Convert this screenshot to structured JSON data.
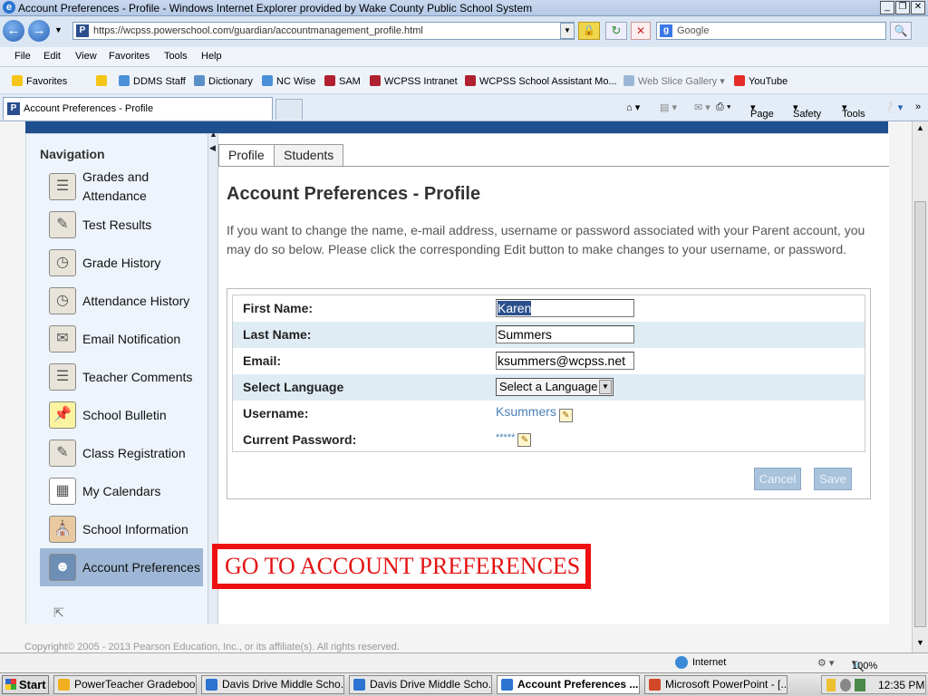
{
  "window": {
    "title": "Account Preferences - Profile - Windows Internet Explorer provided by Wake County Public School System"
  },
  "browser": {
    "url": "https://wcpss.powerschool.com/guardian/accountmanagement_profile.html",
    "search_placeholder": "Google",
    "menu": [
      "File",
      "Edit",
      "View",
      "Favorites",
      "Tools",
      "Help"
    ],
    "favorites_label": "Favorites",
    "favorites": [
      "DDMS Staff",
      "Dictionary",
      "NC Wise",
      "SAM",
      "WCPSS Intranet",
      "WCPSS School Assistant Mo...",
      "Web Slice Gallery",
      "YouTube"
    ],
    "tab_title": "Account Preferences - Profile",
    "commands": [
      "Page",
      "Safety",
      "Tools"
    ],
    "zone": "Internet",
    "zoom": "100%"
  },
  "nav": {
    "heading": "Navigation",
    "items": [
      {
        "label": "Grades and Attendance",
        "icon": "gradebook-icon"
      },
      {
        "label": "Test Results",
        "icon": "test-results-icon"
      },
      {
        "label": "Grade History",
        "icon": "grade-history-icon"
      },
      {
        "label": "Attendance History",
        "icon": "attendance-history-icon"
      },
      {
        "label": "Email Notification",
        "icon": "envelope-icon"
      },
      {
        "label": "Teacher Comments",
        "icon": "comments-icon"
      },
      {
        "label": "School Bulletin",
        "icon": "bulletin-icon"
      },
      {
        "label": "Class Registration",
        "icon": "registration-icon"
      },
      {
        "label": "My Calendars",
        "icon": "calendar-icon"
      },
      {
        "label": "School Information",
        "icon": "school-icon"
      },
      {
        "label": "Account Preferences",
        "icon": "account-icon"
      }
    ]
  },
  "page": {
    "tabs": [
      "Profile",
      "Students"
    ],
    "title": "Account Preferences - Profile",
    "description": "If you want to change the name, e-mail address, username or password associated with your Parent account, you may do so below. Please click the corresponding Edit button to make changes to your username, or password.",
    "form": {
      "first_name_label": "First Name:",
      "first_name": "Karen",
      "last_name_label": "Last Name:",
      "last_name": "Summers",
      "email_label": "Email:",
      "email": "ksummers@wcpss.net",
      "language_label": "Select Language",
      "language_value": "Select a Language",
      "username_label": "Username:",
      "username": "Ksummers",
      "password_label": "Current Password:",
      "password_mask": "*****"
    },
    "cancel_label": "Cancel",
    "save_label": "Save",
    "banner": "GO TO ACCOUNT PREFERENCES",
    "copyright": "Copyright© 2005 - 2013 Pearson Education, Inc., or its affiliate(s). All rights reserved."
  },
  "taskbar": {
    "start": "Start",
    "tasks": [
      "PowerTeacher Gradeboo...",
      "Davis Drive Middle Scho...",
      "Davis Drive Middle Scho...",
      "Account Preferences ...",
      "Microsoft PowerPoint - [..."
    ],
    "clock": "12:35 PM"
  },
  "colors": {
    "banner_border": "#ee1010",
    "banner_text": "#e31313",
    "nav_active": "#9fb7d6",
    "link": "#4a7fb5"
  }
}
